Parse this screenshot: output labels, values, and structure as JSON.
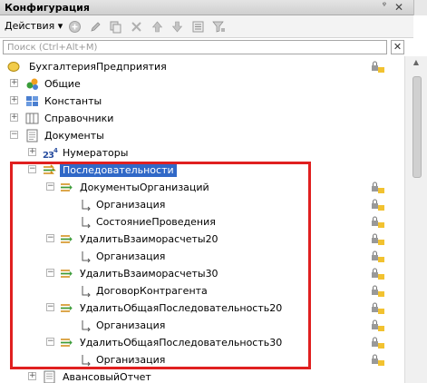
{
  "window": {
    "title": "Конфигурация",
    "pin_glyph": "ᵠ",
    "close_glyph": "✕"
  },
  "toolbar": {
    "actions_label": "Действия ▾",
    "icons": [
      "add-icon",
      "edit-icon",
      "copy-icon",
      "delete-icon",
      "move-up-icon",
      "move-down-icon",
      "list-icon",
      "filter-icon"
    ]
  },
  "search": {
    "placeholder": "Поиск (Ctrl+Alt+M)",
    "clear_glyph": "✕"
  },
  "tree": {
    "root": "БухгалтерияПредприятия",
    "common": "Общие",
    "constants": "Константы",
    "catalogs": "Справочники",
    "documents": "Документы",
    "numerators": "Нумераторы",
    "sequences": "Последовательности",
    "seq1": "ДокументыОрганизаций",
    "seq1_dim1": "Организация",
    "seq1_dim2": "СостояниеПроведения",
    "seq2": "УдалитьВзаиморасчеты20",
    "seq2_dim1": "Организация",
    "seq3": "УдалитьВзаиморасчеты30",
    "seq3_dim1": "ДоговорКонтрагента",
    "seq4": "УдалитьОбщаяПоследовательность20",
    "seq4_dim1": "Организация",
    "seq5": "УдалитьОбщаяПоследовательность30",
    "seq5_dim1": "Организация",
    "doc_advance": "АвансовыйОтчет"
  },
  "colors": {
    "selection": "#3068c7",
    "highlight_border": "#e02020"
  }
}
